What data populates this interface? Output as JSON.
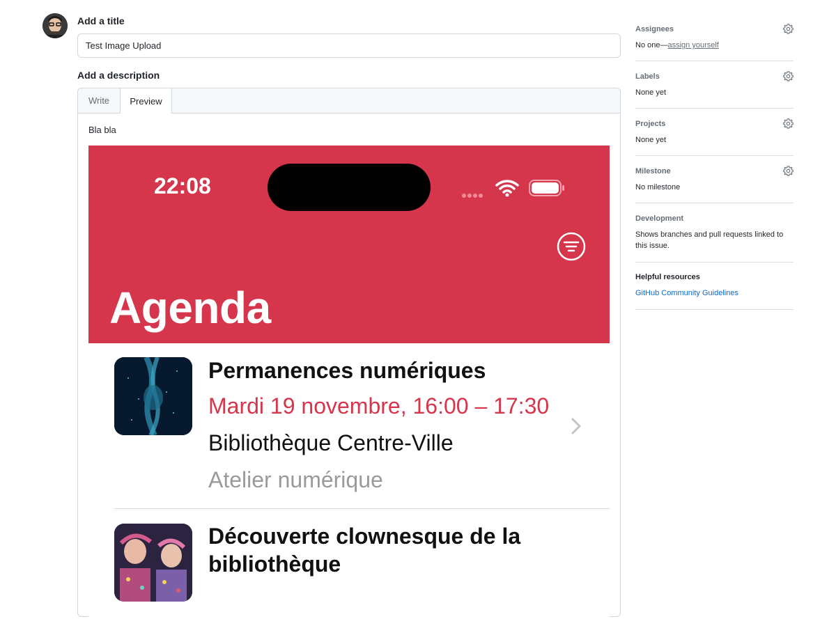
{
  "title_section": {
    "label": "Add a title",
    "value": "Test Image Upload"
  },
  "description_section": {
    "label": "Add a description",
    "tabs": [
      {
        "label": "Write"
      },
      {
        "label": "Preview"
      }
    ],
    "active_tab": "Preview",
    "preview_text": "Bla bla"
  },
  "embedded_screenshot": {
    "status_time": "22:08",
    "header_title": "Agenda",
    "events": [
      {
        "title": "Permanences numériques",
        "datetime": "Mardi 19 novembre, 16:00 – 17:30",
        "place": "Bibliothèque Centre-Ville",
        "category": "Atelier numérique"
      },
      {
        "title": "Découverte clownesque de la bibliothèque"
      }
    ],
    "accent_color": "#d5364b"
  },
  "sidebar": {
    "assignees": {
      "heading": "Assignees",
      "value_prefix": "No one—",
      "value_link": "assign yourself"
    },
    "labels": {
      "heading": "Labels",
      "value": "None yet"
    },
    "projects": {
      "heading": "Projects",
      "value": "None yet"
    },
    "milestone": {
      "heading": "Milestone",
      "value": "No milestone"
    },
    "development": {
      "heading": "Development",
      "value": "Shows branches and pull requests linked to this issue."
    },
    "helpful": {
      "heading": "Helpful resources",
      "link": "GitHub Community Guidelines"
    }
  },
  "icons": [
    "avatar",
    "gear-icon",
    "filter-icon",
    "wifi-icon",
    "battery-icon",
    "chevron-right-icon"
  ]
}
